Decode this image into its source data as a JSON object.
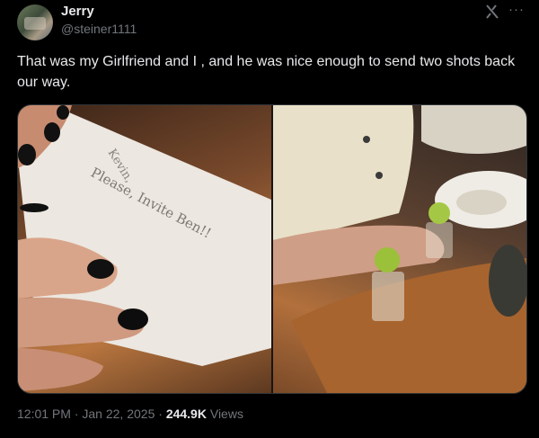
{
  "author": {
    "display_name": "Jerry",
    "handle": "@steiner1111"
  },
  "header_icons": [
    "grok-icon",
    "more-icon"
  ],
  "tweet": {
    "text": "That was my Girlfriend and I , and he was nice enough to send two shots back our way."
  },
  "media": {
    "note_lines": [
      "Kevin,",
      "Please, Invite Ben!!"
    ]
  },
  "meta": {
    "time": "12:01 PM",
    "separator": "·",
    "date": "Jan 22, 2025",
    "views_count": "244.9K",
    "views_label": "Views"
  },
  "colors": {
    "background": "#000000",
    "text": "#e7e9ea",
    "secondary": "#71767b"
  }
}
